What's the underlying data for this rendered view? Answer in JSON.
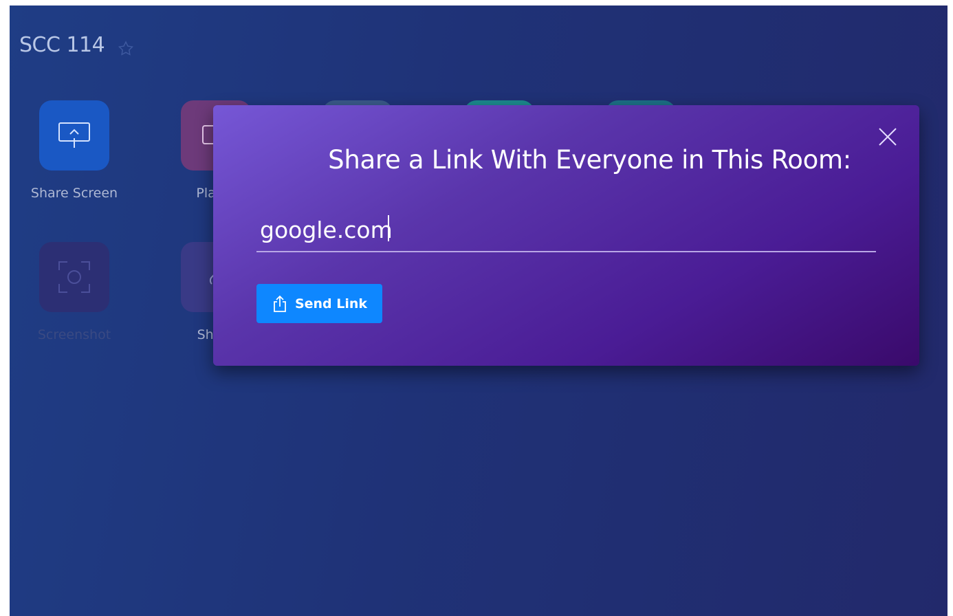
{
  "room": {
    "title": "SCC 114",
    "favorite_icon": "star-outline-icon"
  },
  "tiles": [
    {
      "label": "Share Screen",
      "icon": "screen-share-icon"
    },
    {
      "label": "Play Y",
      "icon": "play-video-icon"
    },
    {
      "label": "Screenshot",
      "icon": "screenshot-icon"
    },
    {
      "label": "Share",
      "icon": "share-link-icon"
    }
  ],
  "modal": {
    "title": "Share a Link With Everyone in This Room:",
    "input_value": "google.com",
    "send_label": "Send Link",
    "send_icon": "upload-share-icon",
    "close_icon": "close-icon"
  },
  "colors": {
    "background_start": "#1f3d85",
    "background_end": "#22296b",
    "modal_start": "#7657d6",
    "modal_end": "#3a0a6b",
    "button_primary": "#0e87ff"
  }
}
